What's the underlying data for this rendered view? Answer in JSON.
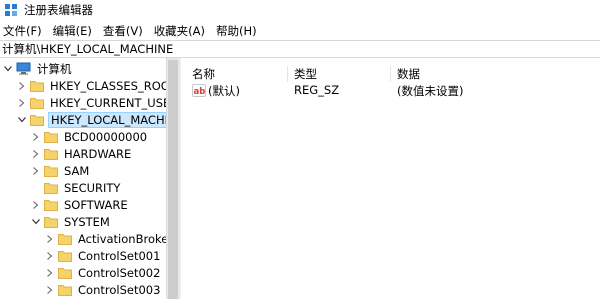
{
  "window": {
    "title": "注册表编辑器"
  },
  "menu": [
    {
      "label": "文件(F)"
    },
    {
      "label": "编辑(E)"
    },
    {
      "label": "查看(V)"
    },
    {
      "label": "收藏夹(A)"
    },
    {
      "label": "帮助(H)"
    }
  ],
  "address": {
    "path": "计算机\\HKEY_LOCAL_MACHINE"
  },
  "tree": {
    "root": "计算机",
    "hives": [
      {
        "label": "HKEY_CLASSES_ROOT"
      },
      {
        "label": "HKEY_CURRENT_USER"
      },
      {
        "label": "HKEY_LOCAL_MACHINE",
        "selected": true,
        "expanded": true
      }
    ],
    "hklm_children": [
      {
        "label": "BCD00000000",
        "expander": "collapsed"
      },
      {
        "label": "HARDWARE",
        "expander": "collapsed"
      },
      {
        "label": "SAM",
        "expander": "collapsed"
      },
      {
        "label": "SECURITY",
        "expander": "none"
      },
      {
        "label": "SOFTWARE",
        "expander": "collapsed"
      },
      {
        "label": "SYSTEM",
        "expander": "expanded"
      }
    ],
    "system_children": [
      {
        "label": "ActivationBroker",
        "expander": "collapsed"
      },
      {
        "label": "ControlSet001",
        "expander": "collapsed"
      },
      {
        "label": "ControlSet002",
        "expander": "collapsed"
      },
      {
        "label": "ControlSet003",
        "expander": "collapsed"
      }
    ]
  },
  "list": {
    "columns": {
      "name": "名称",
      "type": "类型",
      "data": "数据"
    },
    "rows": [
      {
        "name": "(默认)",
        "type": "REG_SZ",
        "data": "(数值未设置)",
        "icon": "string-value-icon"
      }
    ]
  },
  "colors": {
    "folder": "#f5d36a",
    "folder_dark": "#e8b94a",
    "selection": "#cce8ff",
    "selection_border": "#99d1ff",
    "value_icon": "#d83b3b"
  }
}
